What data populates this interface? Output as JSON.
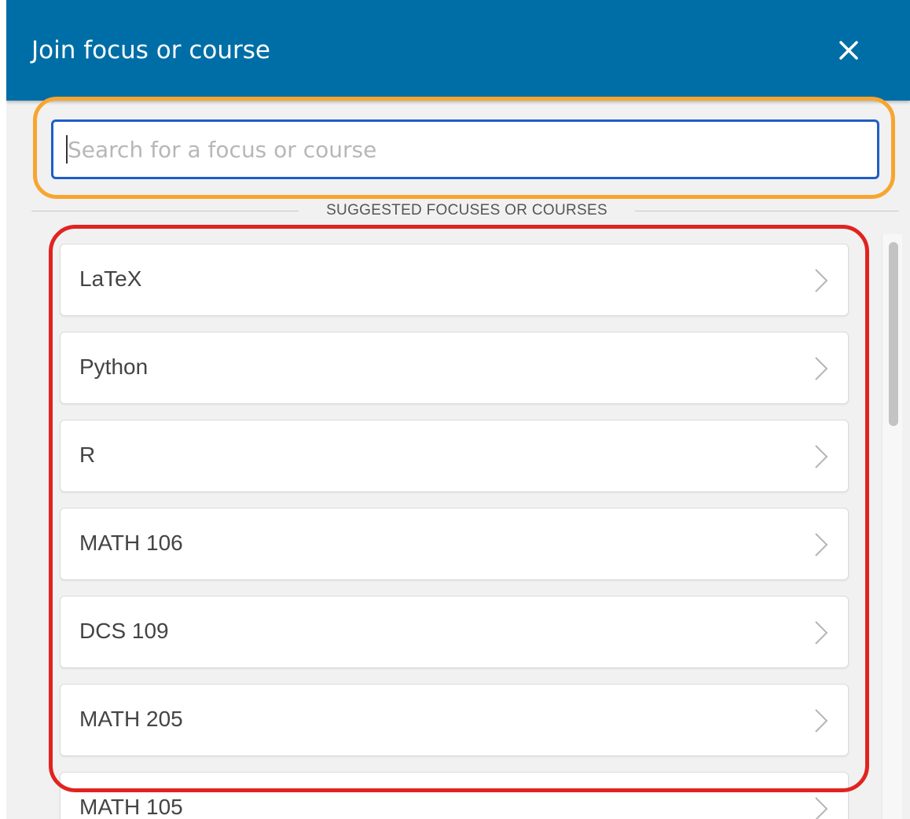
{
  "dialog": {
    "title": "Join focus or course",
    "close_icon": "close-icon"
  },
  "search": {
    "placeholder": "Search for a focus or course",
    "value": ""
  },
  "suggestions": {
    "heading": "SUGGESTED FOCUSES OR COURSES",
    "items": [
      {
        "label": "LaTeX"
      },
      {
        "label": "Python"
      },
      {
        "label": "R"
      },
      {
        "label": "MATH 106"
      },
      {
        "label": "DCS 109"
      },
      {
        "label": "MATH 205"
      },
      {
        "label": "MATH 105"
      }
    ],
    "item_icon": "chevron-right-icon"
  },
  "colors": {
    "header_bg": "#006ea6",
    "search_highlight": "#f8a530",
    "list_highlight": "#e12320",
    "input_border": "#1d5ec8"
  }
}
